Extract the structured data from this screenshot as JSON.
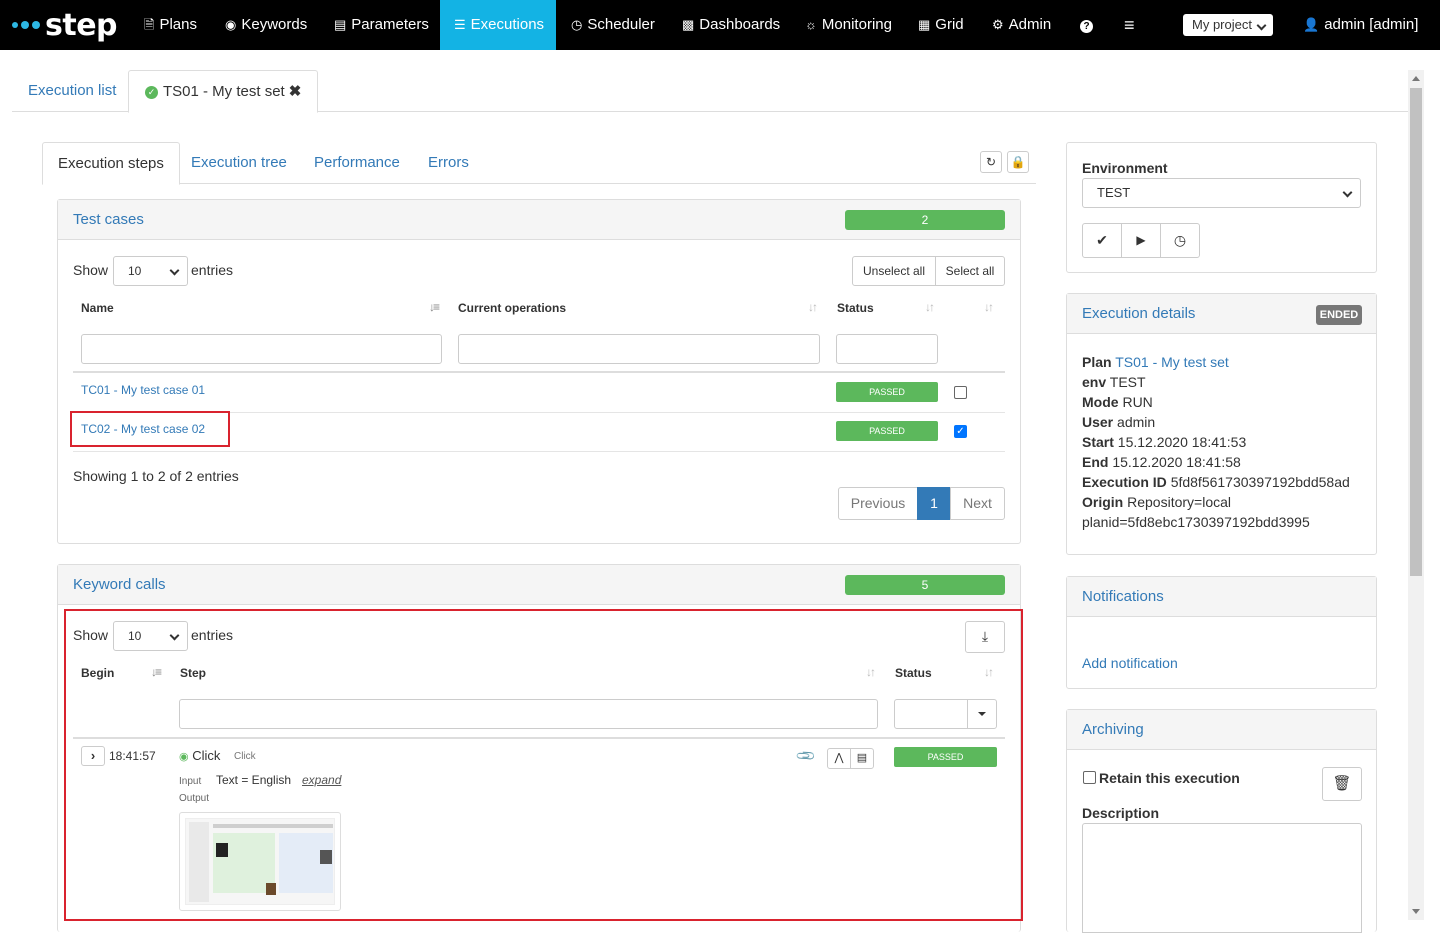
{
  "nav": {
    "logo": "step",
    "items": [
      "Plans",
      "Keywords",
      "Parameters",
      "Executions",
      "Scheduler",
      "Dashboards",
      "Monitoring",
      "Grid",
      "Admin"
    ],
    "help": "?",
    "menu": "≡",
    "project": "My project",
    "user": "admin [admin]"
  },
  "tabs": {
    "list": "Execution list",
    "current": "TS01 - My test set"
  },
  "inner_tabs": [
    "Execution steps",
    "Execution tree",
    "Performance",
    "Errors"
  ],
  "test_cases": {
    "title": "Test cases",
    "count": "2",
    "show": "Show",
    "page_size": "10",
    "entries": "entries",
    "unselect_all": "Unselect all",
    "select_all": "Select all",
    "columns": [
      "Name",
      "Current operations",
      "Status"
    ],
    "rows": [
      {
        "name": "TC01 - My test case 01",
        "status": "PASSED",
        "checked": false
      },
      {
        "name": "TC02 - My test case 02",
        "status": "PASSED",
        "checked": true
      }
    ],
    "info": "Showing 1 to 2 of 2 entries",
    "pager": {
      "prev": "Previous",
      "page": "1",
      "next": "Next"
    }
  },
  "keyword_calls": {
    "title": "Keyword calls",
    "count": "5",
    "show": "Show",
    "page_size": "10",
    "entries": "entries",
    "columns": [
      "Begin",
      "Step",
      "Status"
    ],
    "row": {
      "begin": "18:41:57",
      "name": "Click",
      "name_small": "Click",
      "input_label": "Input",
      "input_value": "Text = English",
      "expand": "expand",
      "output_label": "Output",
      "status": "PASSED"
    }
  },
  "environment": {
    "label": "Environment",
    "value": "TEST"
  },
  "execution_details": {
    "title": "Execution details",
    "state": "ENDED",
    "plan_label": "Plan",
    "plan": "TS01 - My test set",
    "env_label": "env",
    "env": "TEST",
    "mode_label": "Mode",
    "mode": "RUN",
    "user_label": "User",
    "user": "admin",
    "start_label": "Start",
    "start": "15.12.2020 18:41:53",
    "end_label": "End",
    "end": "15.12.2020 18:41:58",
    "id_label": "Execution ID",
    "id": "5fd8f561730397192bdd58ad",
    "origin_label": "Origin",
    "origin1": "Repository=local",
    "origin2": "planid=5fd8ebc1730397192bdd3995"
  },
  "notifications": {
    "title": "Notifications",
    "add": "Add notification"
  },
  "archiving": {
    "title": "Archiving",
    "retain": "Retain this execution",
    "description": "Description"
  },
  "colors": {
    "accent": "#13b3e4",
    "success": "#5cb85c",
    "link": "#337ab7",
    "highlight": "#d9232e"
  }
}
